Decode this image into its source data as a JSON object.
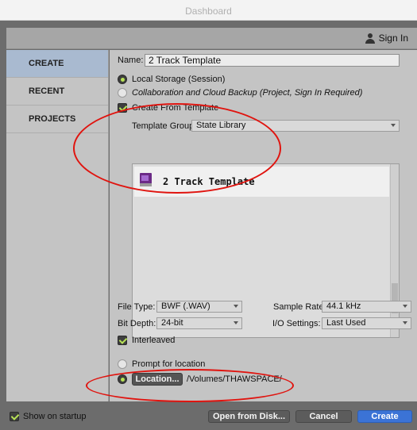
{
  "window": {
    "title": "Dashboard"
  },
  "header": {
    "signin_label": "Sign In"
  },
  "sidebar": {
    "items": [
      {
        "label": "CREATE"
      },
      {
        "label": "RECENT"
      },
      {
        "label": "PROJECTS"
      }
    ]
  },
  "create": {
    "name_label": "Name:",
    "name_value": "2 Track Template",
    "local_storage_label": "Local Storage (Session)",
    "cloud_backup_label": "Collaboration and Cloud Backup (Project, Sign In Required)",
    "create_from_template_label": "Create From Template",
    "template_group_label": "Template Group:",
    "template_group_value": "State Library",
    "templates": [
      {
        "name": "2 Track Template",
        "icon": "session-template-icon"
      }
    ],
    "file_type_label": "File Type:",
    "file_type_value": "BWF (.WAV)",
    "sample_rate_label": "Sample Rate:",
    "sample_rate_value": "44.1 kHz",
    "bit_depth_label": "Bit Depth:",
    "bit_depth_value": "24-bit",
    "io_settings_label": "I/O Settings:",
    "io_settings_value": "Last Used",
    "interleaved_label": "Interleaved",
    "prompt_location_label": "Prompt for location",
    "location_button": "Location...",
    "location_path": "/Volumes/THAWSPACE/"
  },
  "footer": {
    "show_on_startup_label": "Show on startup",
    "open_from_disk": "Open from Disk...",
    "cancel": "Cancel",
    "create": "Create"
  },
  "colors": {
    "accent_green": "#b8e356",
    "primary_button": "#3b73d6",
    "annotation_red": "#e0140f",
    "sidebar_active": "#a9bad0"
  }
}
